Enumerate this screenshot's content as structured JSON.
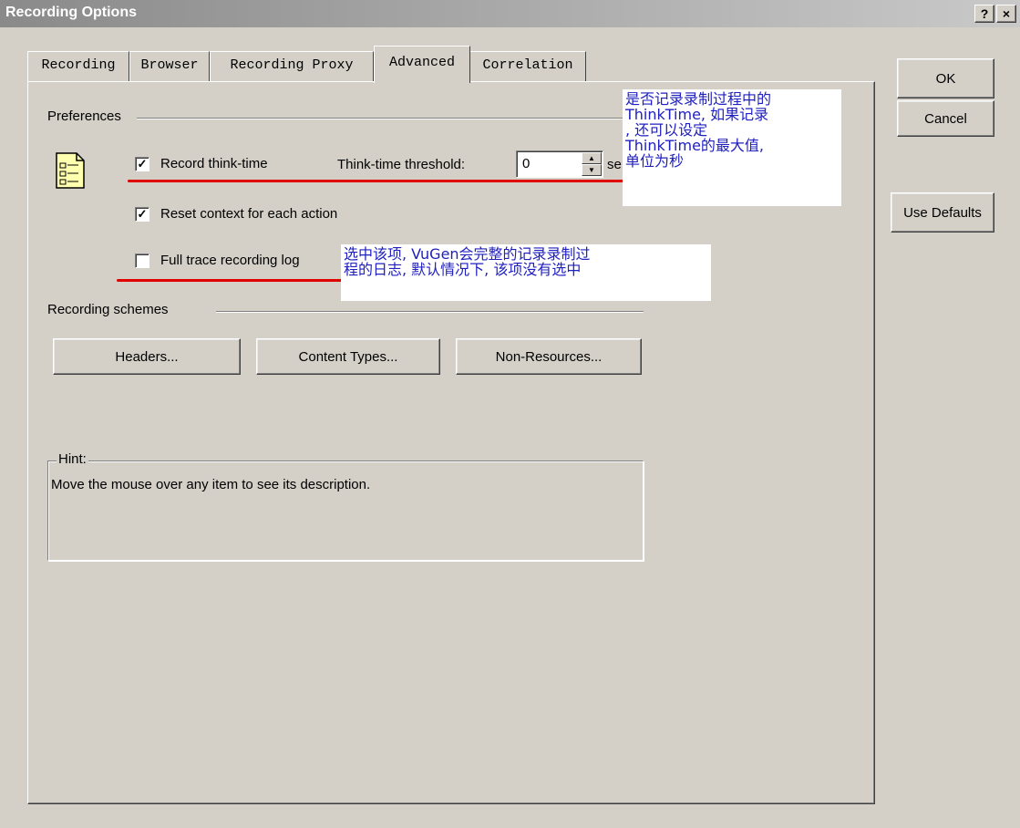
{
  "window": {
    "title": "Recording Options",
    "help_label": "?",
    "close_label": "×"
  },
  "tabs": [
    {
      "label": "Recording",
      "active": false
    },
    {
      "label": "Browser",
      "active": false
    },
    {
      "label": "Recording Proxy",
      "active": false
    },
    {
      "label": "Advanced",
      "active": true
    },
    {
      "label": "Correlation",
      "active": false
    }
  ],
  "preferences": {
    "group_label": "Preferences",
    "record_think_time": {
      "label": "Record think-time",
      "checked": true
    },
    "threshold_label": "Think-time threshold:",
    "threshold_value": "0",
    "threshold_unit": "se",
    "reset_context": {
      "label": "Reset context for each action",
      "checked": true
    },
    "full_trace": {
      "label": "Full trace recording log",
      "checked": false
    }
  },
  "recording_schemes": {
    "group_label": "Recording schemes",
    "headers_label": "Headers...",
    "content_types_label": "Content Types...",
    "non_resources_label": "Non-Resources..."
  },
  "hint": {
    "legend": "Hint:",
    "text": "Move the mouse over any item to see its description."
  },
  "side_buttons": {
    "ok": "OK",
    "cancel": "Cancel",
    "use_defaults": "Use Defaults"
  },
  "annotations": {
    "think_time_note": "是否记录录制过程中的\nThinkTime, 如果记录\n, 还可以设定\nThinkTime的最大值,\n单位为秒",
    "trace_note": "选中该项, VuGen会完整的记录录制过\n程的日志, 默认情况下, 该项没有选中"
  },
  "colors": {
    "dialog_bg": "#d4d0c8",
    "annotation_text": "#2020c0",
    "annotation_underline": "#e00000"
  },
  "icons": {
    "settings_doc": "document-settings-icon",
    "help": "help-icon",
    "close": "close-icon"
  }
}
